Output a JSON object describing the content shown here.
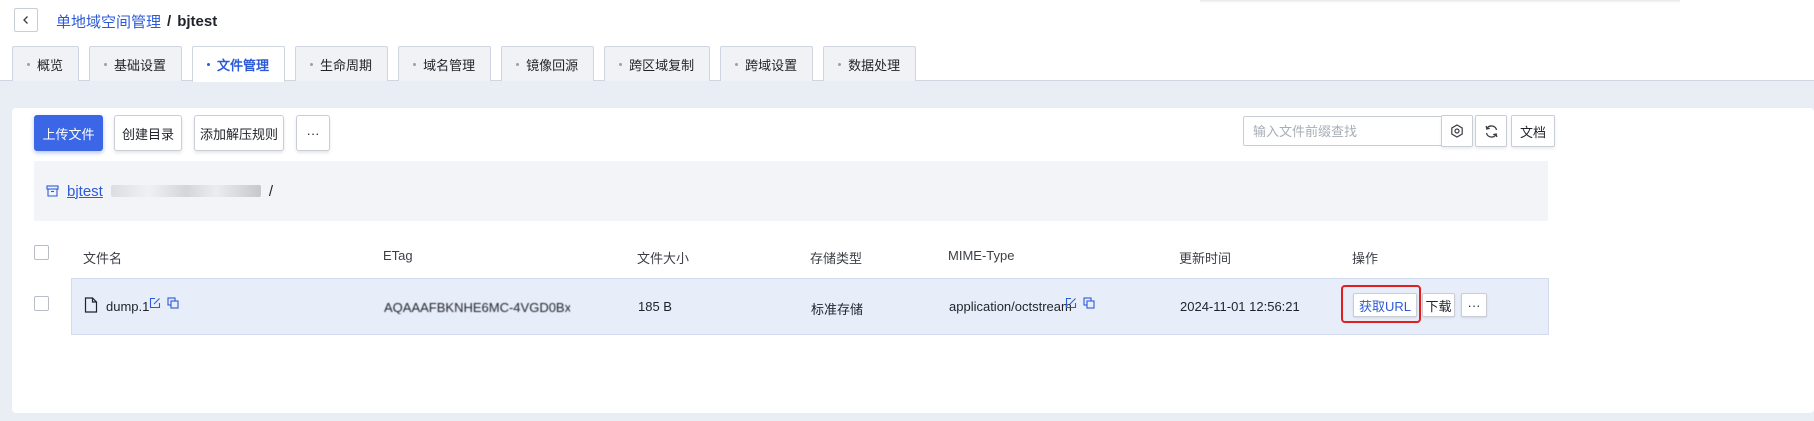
{
  "breadcrumb": {
    "parent": "单地域空间管理",
    "separator": "/",
    "current": "bjtest"
  },
  "tabs": [
    {
      "label": "概览"
    },
    {
      "label": "基础设置"
    },
    {
      "label": "文件管理"
    },
    {
      "label": "生命周期"
    },
    {
      "label": "域名管理"
    },
    {
      "label": "镜像回源"
    },
    {
      "label": "跨区域复制"
    },
    {
      "label": "跨域设置"
    },
    {
      "label": "数据处理"
    }
  ],
  "active_tab": "文件管理",
  "toolbar": {
    "upload": "上传文件",
    "create_dir": "创建目录",
    "add_rule": "添加解压规则",
    "more": "···",
    "search_placeholder": "输入文件前缀查找",
    "doc": "文档"
  },
  "path": {
    "bucket": "bjtest",
    "rest": "/"
  },
  "table": {
    "headers": [
      "文件名",
      "ETag",
      "文件大小",
      "存储类型",
      "MIME-Type",
      "更新时间",
      "操作"
    ],
    "rows": [
      {
        "name": "dump.1",
        "etag": "AQAAAFBKNHE6MC-4VGD0Bxda...",
        "size": "185 B",
        "storage": "标准存储",
        "mime": "application/octstream",
        "updated": "2024-11-01 12:56:21",
        "actions": {
          "get_url": "获取URL",
          "download": "下载",
          "more": "···"
        }
      }
    ]
  },
  "colors": {
    "accent": "#2d5bd8",
    "highlight": "#e21f1f",
    "row_selected": "#e8edfa"
  }
}
